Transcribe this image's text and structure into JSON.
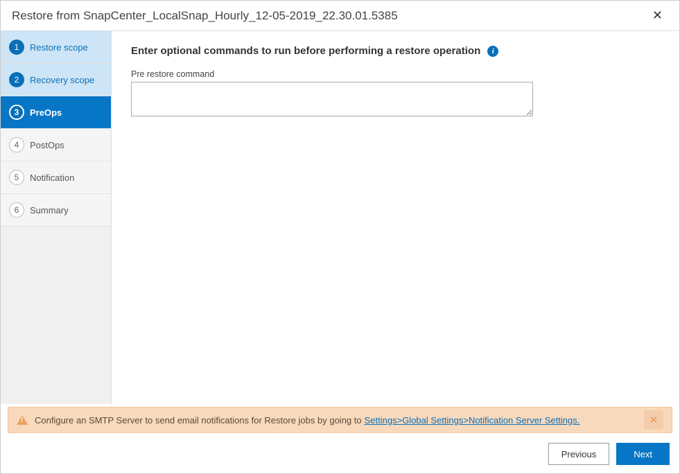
{
  "dialog": {
    "title": "Restore from SnapCenter_LocalSnap_Hourly_12-05-2019_22.30.01.5385"
  },
  "sidebar": {
    "steps": [
      {
        "num": "1",
        "label": "Restore scope",
        "state": "completed"
      },
      {
        "num": "2",
        "label": "Recovery scope",
        "state": "completed"
      },
      {
        "num": "3",
        "label": "PreOps",
        "state": "active"
      },
      {
        "num": "4",
        "label": "PostOps",
        "state": "pending"
      },
      {
        "num": "5",
        "label": "Notification",
        "state": "pending"
      },
      {
        "num": "6",
        "label": "Summary",
        "state": "pending"
      }
    ]
  },
  "main": {
    "heading": "Enter optional commands to run before performing a restore operation",
    "info_icon": "i",
    "field_label": "Pre restore command",
    "command_value": ""
  },
  "notification": {
    "text": "Configure an SMTP Server to send email notifications for Restore jobs by going to",
    "link": "Settings>Global Settings>Notification Server Settings."
  },
  "footer": {
    "previous": "Previous",
    "next": "Next"
  }
}
